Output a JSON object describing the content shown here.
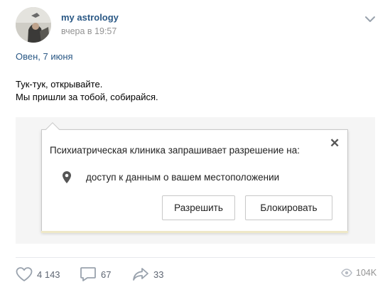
{
  "post": {
    "author": "my astrology",
    "time": "вчера в 19:57",
    "tagline": "Овен, 7 июня",
    "text_line1": "Тук-тук, открывайте.",
    "text_line2": "Мы пришли за тобой, собирайся.",
    "menu_icon": "chevron-down-icon"
  },
  "dialog": {
    "title": "Психиатрическая клиника запрашивает разрешение на:",
    "close": "✕",
    "permission": "доступ к данным о вашем местоположении",
    "permission_icon": "location-pin-icon",
    "allow_label": "Разрешить",
    "block_label": "Блокировать"
  },
  "actions": {
    "likes": "4 143",
    "comments": "67",
    "shares": "33",
    "views": "104K"
  },
  "colors": {
    "link": "#2a5885",
    "muted": "#939393",
    "action": "#5e6673"
  }
}
